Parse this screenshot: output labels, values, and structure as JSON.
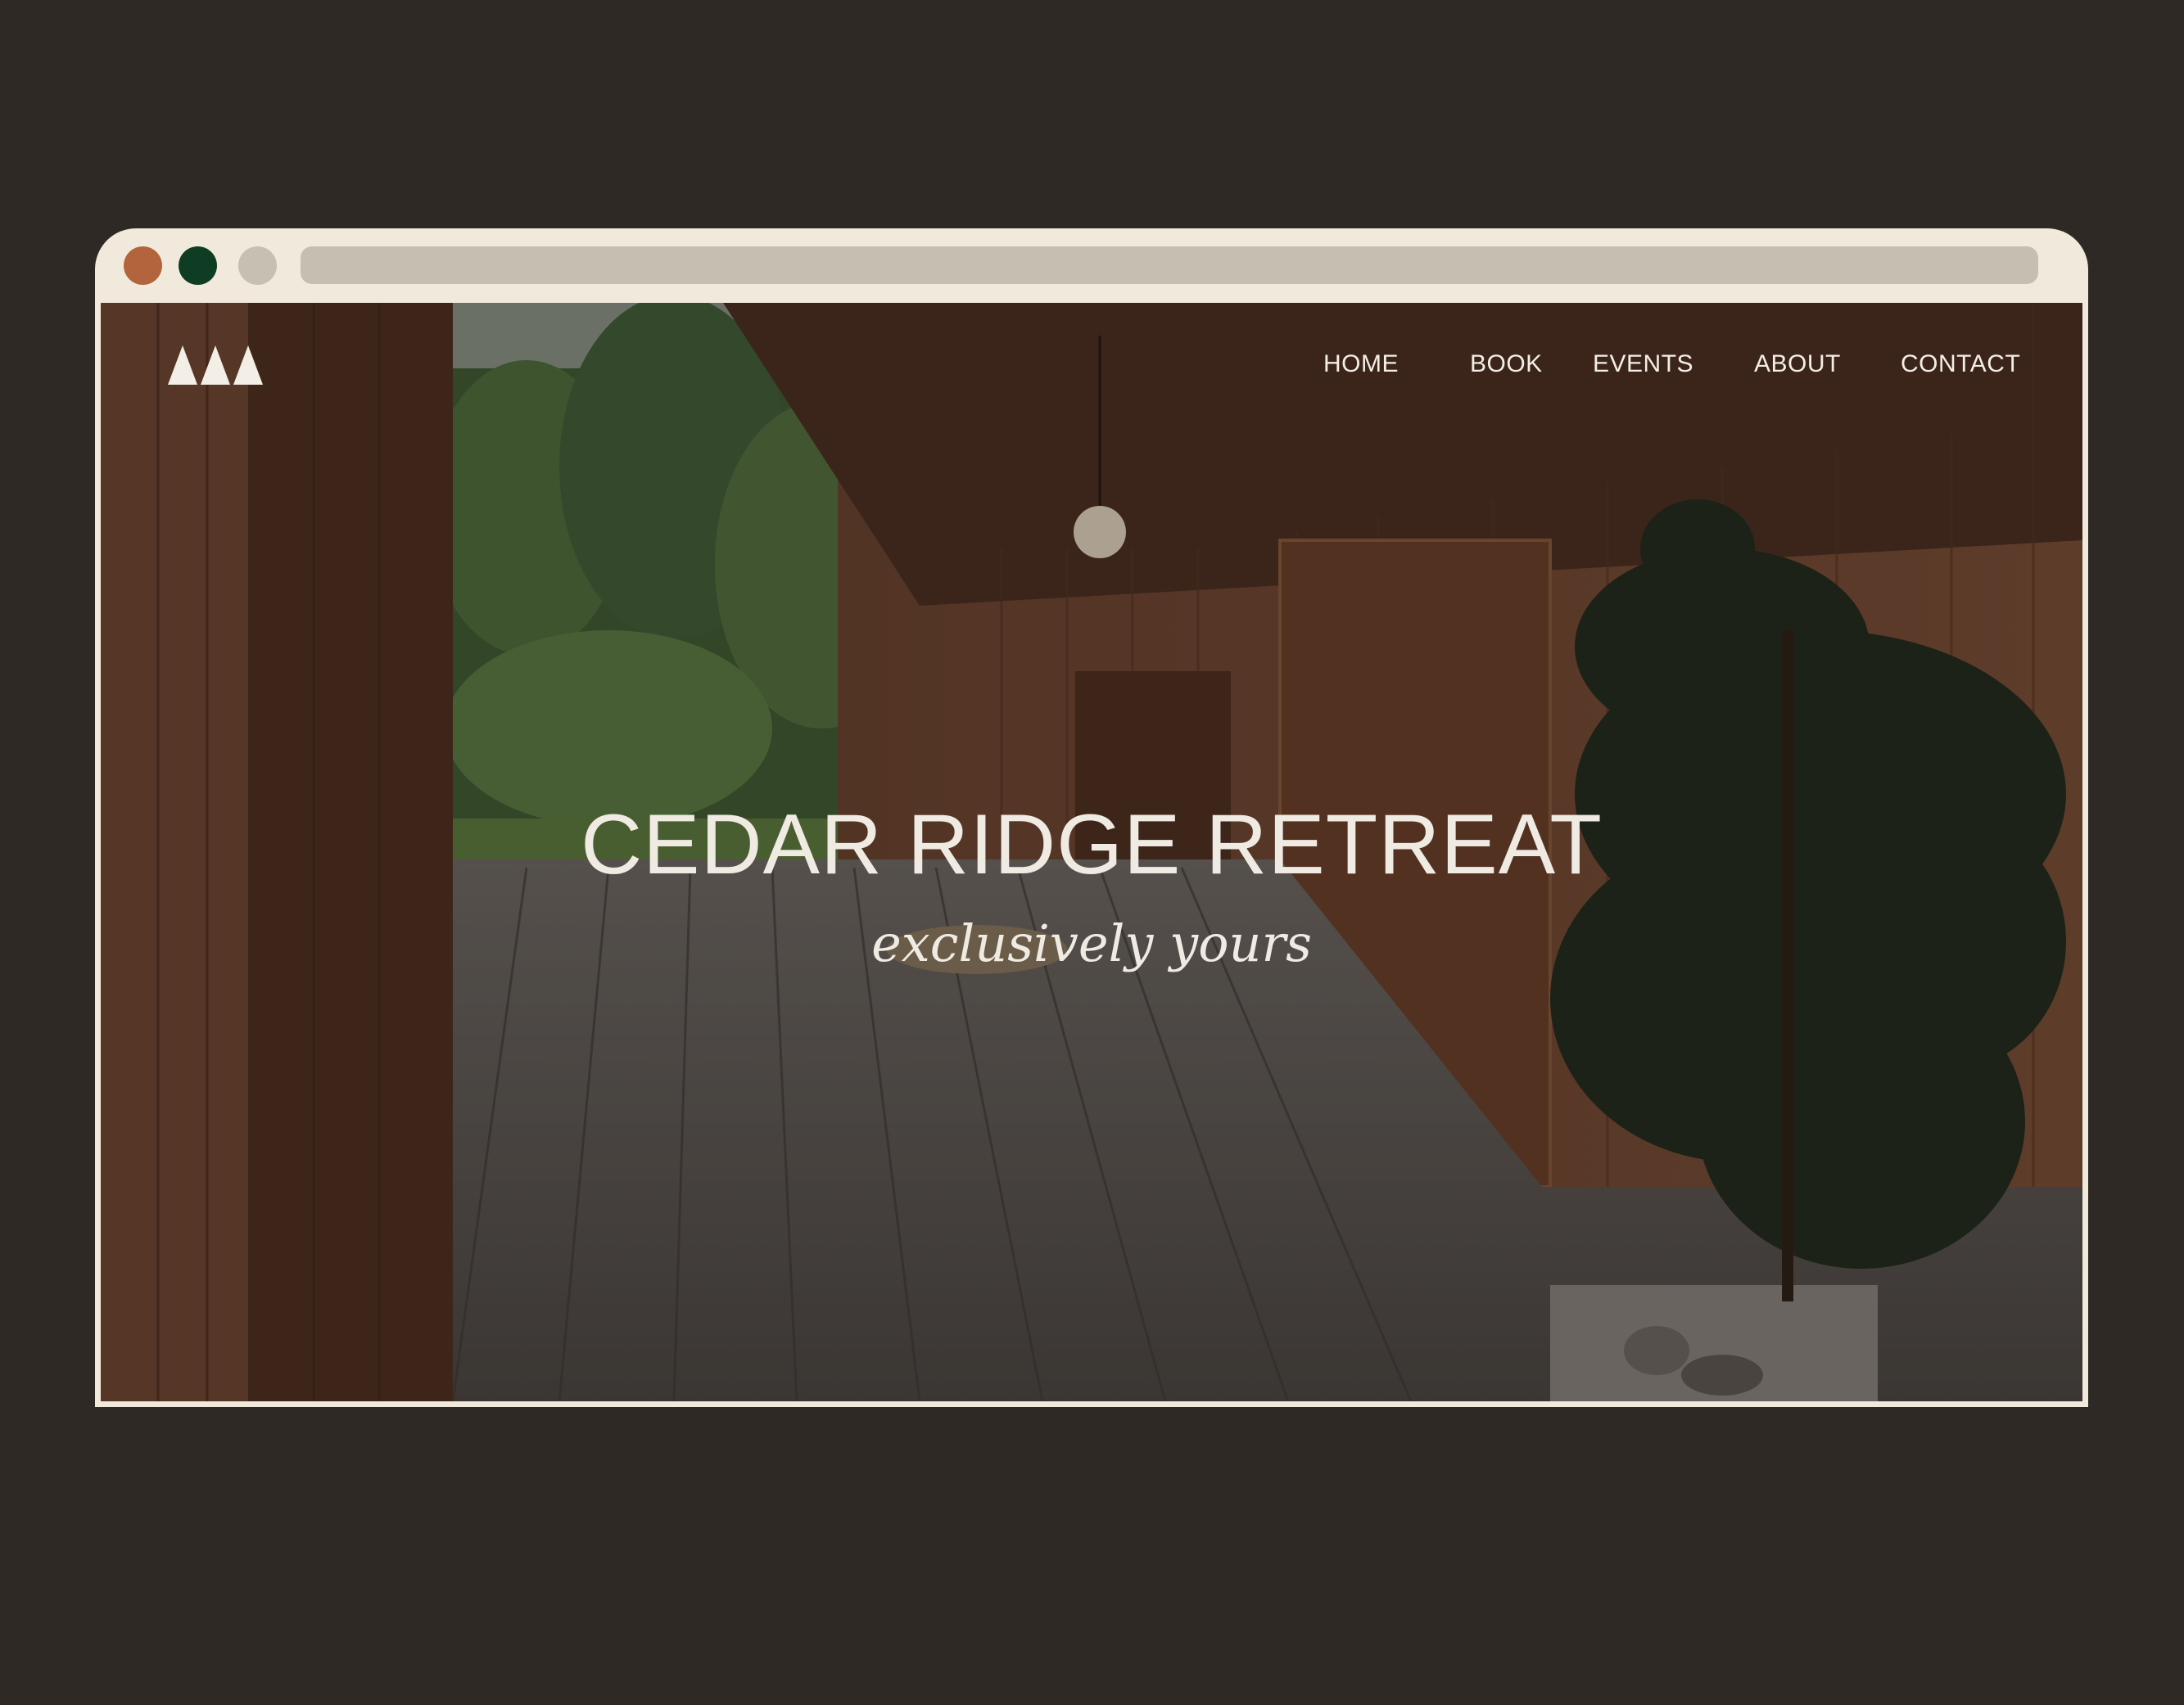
{
  "window": {
    "controls": [
      "close",
      "minimize",
      "maximize"
    ],
    "control_colors": [
      "#b4643c",
      "#0e3d23",
      "#c6bfb2"
    ],
    "address_bar_value": ""
  },
  "site": {
    "logo_icon": "three-triangles-icon",
    "nav": [
      {
        "label": "HOME"
      },
      {
        "label": "BOOK"
      },
      {
        "label": "EVENTS"
      },
      {
        "label": "ABOUT"
      },
      {
        "label": "CONTACT"
      }
    ],
    "hero": {
      "title": "CEDAR RIDGE RETREAT",
      "subtitle": "exclusively yours"
    }
  },
  "colors": {
    "page_background": "#2e2924",
    "browser_frame": "#f1eadc",
    "text": "#efeae2"
  }
}
